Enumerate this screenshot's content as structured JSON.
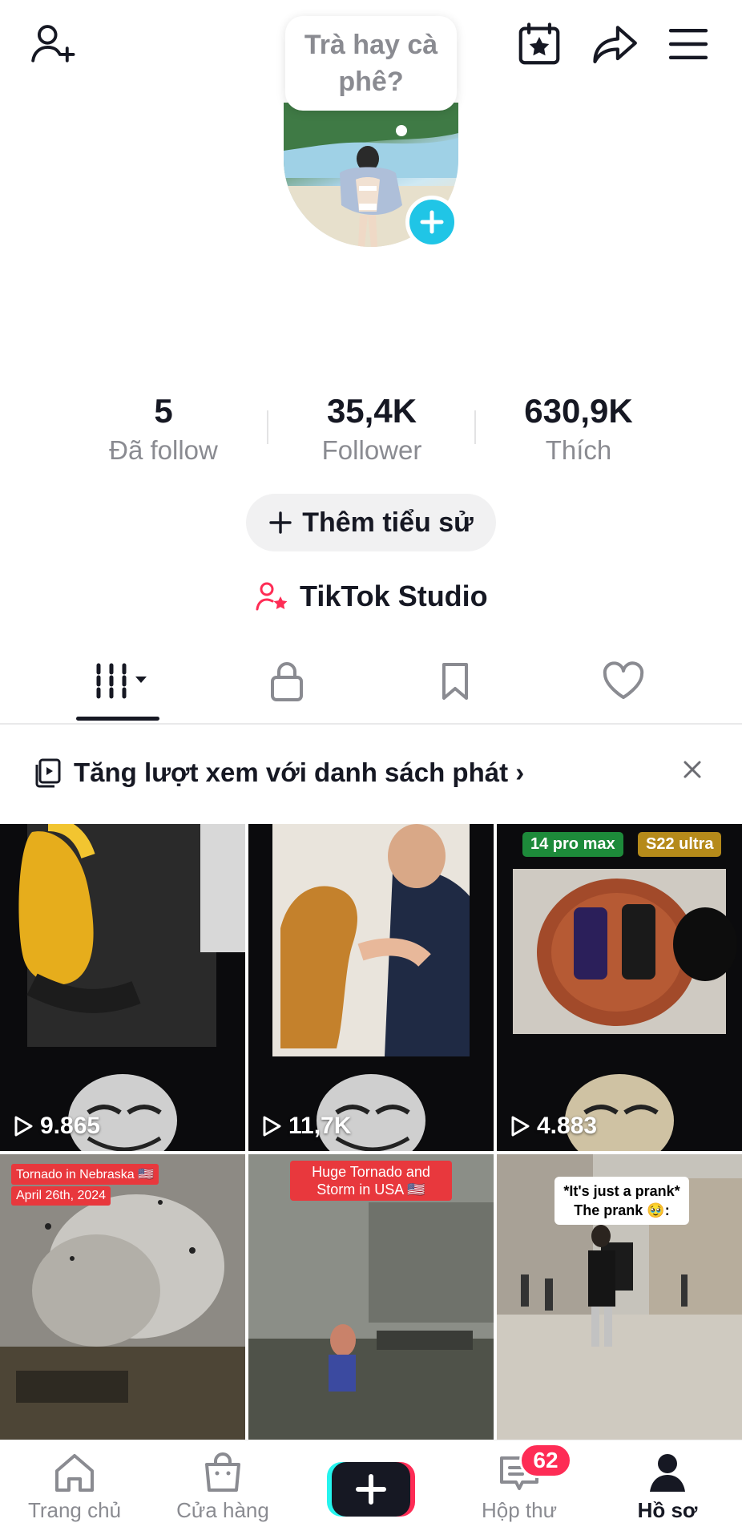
{
  "header": {
    "bubble_text": "Trà hay cà phê?",
    "icons": [
      "add-friend-icon",
      "calendar-star-icon",
      "share-icon",
      "menu-icon"
    ]
  },
  "stats": [
    {
      "value": "5",
      "label": "Đã follow"
    },
    {
      "value": "35,4K",
      "label": "Follower"
    },
    {
      "value": "630,9K",
      "label": "Thích"
    }
  ],
  "bio_button": {
    "label": "Thêm tiểu sử"
  },
  "studio": {
    "label": "TikTok Studio"
  },
  "tabs": [
    "videos-grid-icon",
    "lock-icon",
    "bookmark-icon",
    "heart-icon"
  ],
  "playlist_banner": {
    "text": "Tăng lượt xem với danh sách phát ›"
  },
  "videos": [
    {
      "views": "9.865"
    },
    {
      "views": "11,7K"
    },
    {
      "views": "4.883",
      "tags": [
        "14 pro max",
        "S22 ultra"
      ]
    },
    {
      "tags": [
        "Tornado in Nebraska 🇺🇸",
        "April 26th, 2024"
      ]
    },
    {
      "tags": [
        "Huge Tornado and Storm in USA 🇺🇸"
      ]
    },
    {
      "tags": [
        "*It's just a prank* The prank 🥹:"
      ]
    }
  ],
  "nav": {
    "home": "Trang chủ",
    "shop": "Cửa hàng",
    "inbox": "Hộp thư",
    "inbox_badge": "62",
    "profile": "Hồ sơ"
  },
  "colors": {
    "accent_cyan": "#20c5e6",
    "accent_red": "#fe2c55",
    "text": "#161823",
    "muted": "#8a8b91"
  }
}
